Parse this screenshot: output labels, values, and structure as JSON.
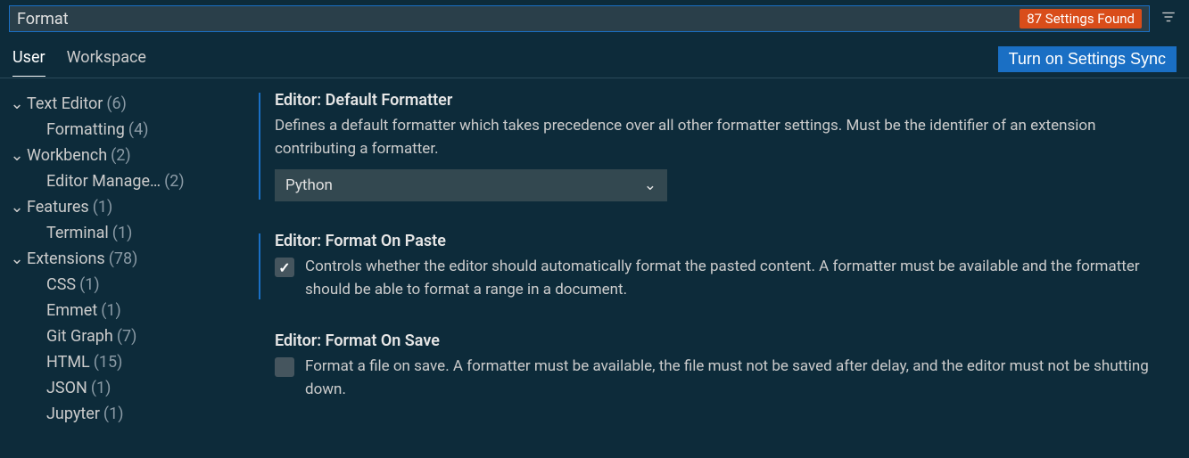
{
  "search": {
    "value": "Format",
    "results_badge": "87 Settings Found"
  },
  "tabs": {
    "user": "User",
    "workspace": "Workspace"
  },
  "sync_button": "Turn on Settings Sync",
  "tree": {
    "text_editor": {
      "label": "Text Editor",
      "count": "(6)"
    },
    "formatting": {
      "label": "Formatting",
      "count": "(4)"
    },
    "workbench": {
      "label": "Workbench",
      "count": "(2)"
    },
    "editor_mgmt": {
      "label": "Editor Manage…",
      "count": "(2)"
    },
    "features": {
      "label": "Features",
      "count": "(1)"
    },
    "terminal": {
      "label": "Terminal",
      "count": "(1)"
    },
    "extensions": {
      "label": "Extensions",
      "count": "(78)"
    },
    "css": {
      "label": "CSS",
      "count": "(1)"
    },
    "emmet": {
      "label": "Emmet",
      "count": "(1)"
    },
    "gitgraph": {
      "label": "Git Graph",
      "count": "(7)"
    },
    "html": {
      "label": "HTML",
      "count": "(15)"
    },
    "json": {
      "label": "JSON",
      "count": "(1)"
    },
    "jupyter": {
      "label": "Jupyter",
      "count": "(1)"
    }
  },
  "settings": {
    "default_formatter": {
      "title": "Editor: Default Formatter",
      "desc": "Defines a default formatter which takes precedence over all other formatter settings. Must be the identifier of an extension contributing a formatter.",
      "value": "Python"
    },
    "format_on_paste": {
      "title": "Editor: Format On Paste",
      "desc": "Controls whether the editor should automatically format the pasted content. A formatter must be available and the formatter should be able to format a range in a document."
    },
    "format_on_save": {
      "title": "Editor: Format On Save",
      "desc": "Format a file on save. A formatter must be available, the file must not be saved after delay, and the editor must not be shutting down."
    }
  }
}
